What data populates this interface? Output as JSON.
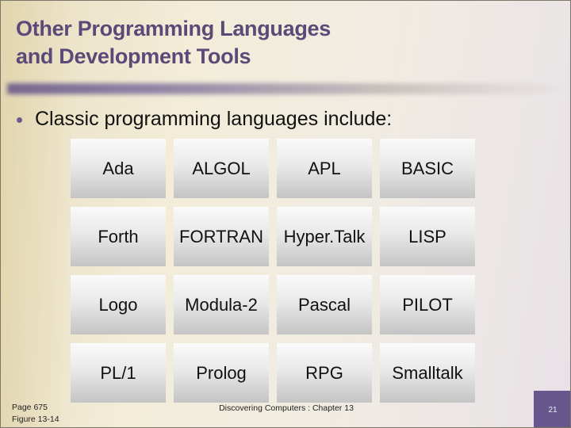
{
  "slide": {
    "title_line1": "Other Programming Languages",
    "title_line2": "and Development Tools",
    "bullet": "Classic programming languages include:",
    "languages": [
      [
        "Ada",
        "ALGOL",
        "APL",
        "BASIC"
      ],
      [
        "Forth",
        "FORTRAN",
        "Hyper.Talk",
        "LISP"
      ],
      [
        "Logo",
        "Modula-2",
        "Pascal",
        "PILOT"
      ],
      [
        "PL/1",
        "Prolog",
        "RPG",
        "Smalltalk"
      ]
    ]
  },
  "footer": {
    "page_ref": "Page 675",
    "figure_ref": "Figure 13-14",
    "center_text": "Discovering Computers : Chapter 13",
    "slide_number": "21"
  },
  "colors": {
    "title": "#5b4a78",
    "accent": "#65568e"
  }
}
